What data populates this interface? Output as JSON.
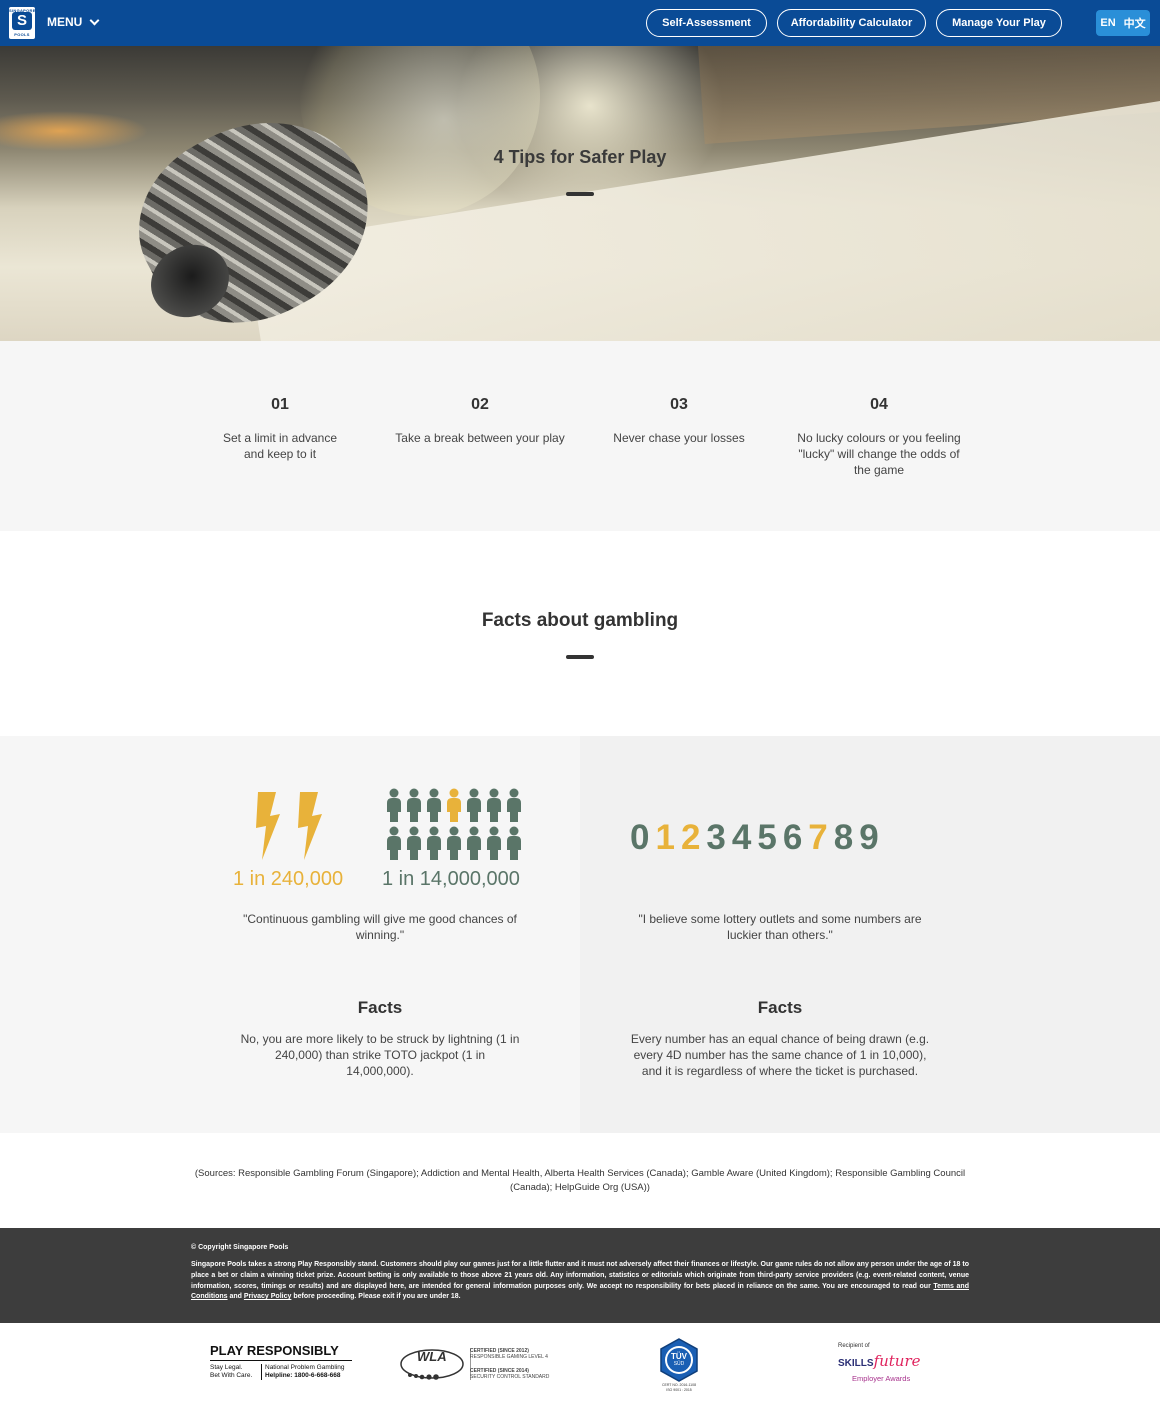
{
  "nav": {
    "brand_top": "SINGAPORE",
    "brand_letter": "S",
    "brand_bottom": "POOLS",
    "menu_label": "MENU",
    "buttons": [
      "Self-Assessment",
      "Affordability Calculator",
      "Manage Your Play"
    ],
    "lang_en": "EN",
    "lang_zh": "中文",
    "colors": {
      "bar": "#0a4b96",
      "lang": "#2a8fd8"
    }
  },
  "hero": {
    "title": "4 Tips for Safer Play"
  },
  "tips": [
    {
      "num": "01",
      "text": "Set a limit in advance and keep to it"
    },
    {
      "num": "02",
      "text": "Take a break between your play"
    },
    {
      "num": "03",
      "text": "Never chase your losses"
    },
    {
      "num": "04",
      "text": "No lucky colours or you feeling \"lucky\" will change the odds of the game"
    }
  ],
  "facts_section": {
    "title": "Facts about gambling",
    "left": {
      "odds_lightning": "1 in 240,000",
      "odds_toto": "1 in 14,000,000",
      "quote": "\"Continuous gambling will give me good chances of winning.\"",
      "facts_heading": "Facts",
      "facts_text": "No, you are more likely to be struck by lightning (1 in 240,000) than strike TOTO jackpot (1 in 14,000,000)."
    },
    "right": {
      "digits": [
        "0",
        "1",
        "2",
        "3",
        "4",
        "5",
        "6",
        "7",
        "8",
        "9"
      ],
      "highlight_digits": [
        "1",
        "2",
        "7"
      ],
      "quote": "\"I believe some lottery outlets and some numbers are luckier than others.\"",
      "facts_heading": "Facts",
      "facts_text": "Every number has an equal chance of being drawn (e.g. every 4D number has the same chance of 1 in 10,000), and it is regardless of where the ticket is purchased."
    },
    "colors": {
      "gold": "#e8b23a",
      "slate": "#5a7568"
    }
  },
  "sources": "(Sources: Responsible Gambling Forum (Singapore); Addiction and Mental Health, Alberta Health Services (Canada); Gamble Aware (United Kingdom); Responsible Gambling Council (Canada); HelpGuide Org (USA))",
  "footer": {
    "copyright": "© Copyright Singapore Pools",
    "disclaimer_part1": "Singapore Pools takes a strong Play Responsibly stand. Customers should play our games just for a little flutter and it must not adversely affect their finances or lifestyle. Our game rules do not allow any person under the age of 18 to place a bet or claim a winning ticket prize. Account betting is only available to those above 21 years old. Any information, statistics or editorials which originate from third-party service providers (e.g. event-related content, venue information, scores, timings or results) and are displayed here, are intended for general information purposes only. We accept no responsibility for bets placed in reliance on the same. You are encouraged to read our ",
    "terms_link": "Terms and Conditions",
    "and_text": " and ",
    "privacy_link": "Privacy Policy",
    "disclaimer_part2": " before proceeding. Please exit if you are under 18."
  },
  "badges": {
    "play_responsibly": {
      "title": "PLAY RESPONSIBLY",
      "line1_left": "Stay Legal.",
      "line2_left": "Bet With Care.",
      "line1_right": "National Problem Gambling",
      "line2_right": "Helpline: 1800-6-668-668"
    },
    "wla": {
      "mark": "WLA",
      "small": "WORLD LOTTERY ASSOCIATION",
      "cert1_title": "CERTIFIED (SINCE 2012)",
      "cert1_text": "RESPONSIBLE GAMING LEVEL 4",
      "cert2_title": "CERTIFIED (SINCE 2014)",
      "cert2_text": "SECURITY CONTROL STANDARD"
    },
    "tuv": {
      "mark": "TÜV",
      "sub": "SÜD",
      "cert": "CERT NO. 2016-1108",
      "iso": "ISO 9001 : 2015"
    },
    "skills": {
      "recipient": "Recipient of",
      "skills": "SKILLS",
      "future": "future",
      "awards": "Employer Awards"
    }
  }
}
